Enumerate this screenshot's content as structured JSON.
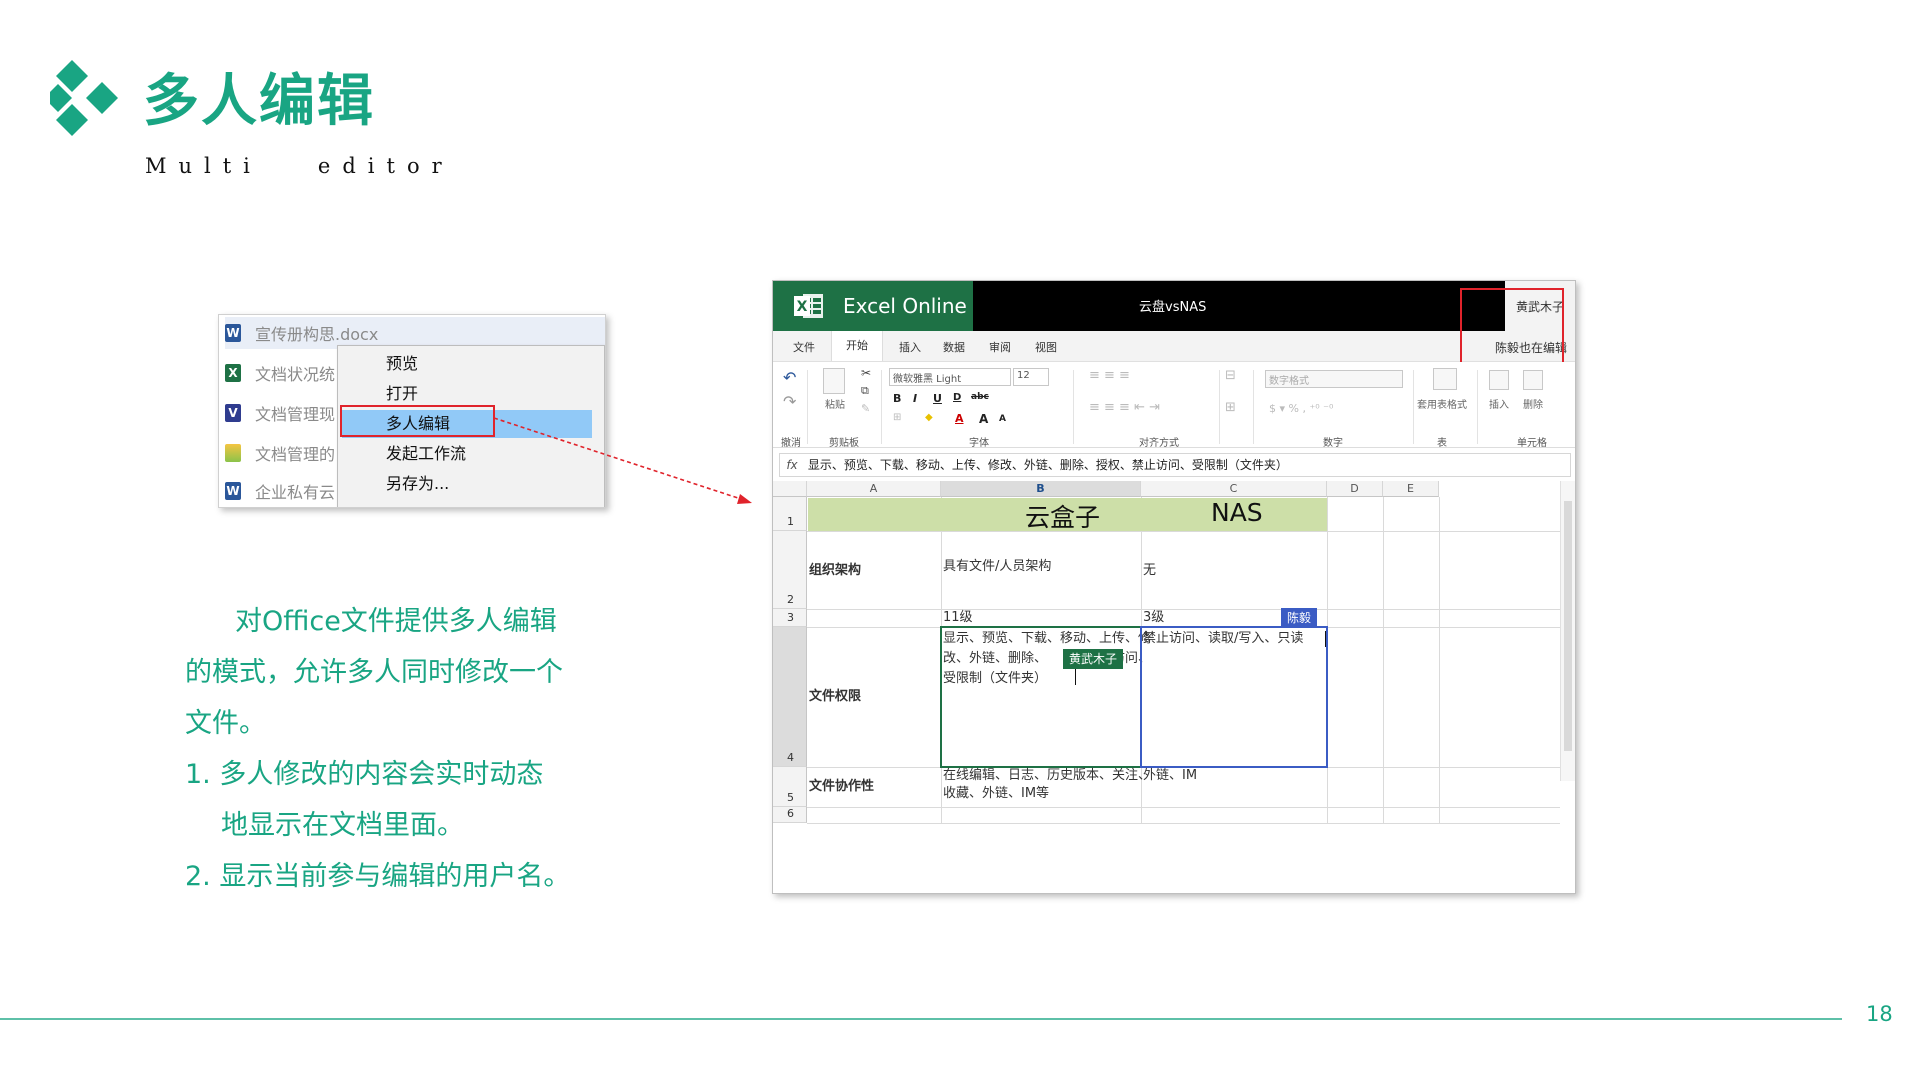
{
  "slide": {
    "title": "多人编辑",
    "subtitle": "Multi   editor",
    "page_number": "18",
    "accent_color": "#19a583"
  },
  "context_menu_screenshot": {
    "files": [
      {
        "icon": "word-icon",
        "letter": "W",
        "name": "宣传册构思.docx"
      },
      {
        "icon": "excel-icon",
        "letter": "X",
        "name": "文档状况统"
      },
      {
        "icon": "visio-icon",
        "letter": "V",
        "name": "文档管理现"
      },
      {
        "icon": "image-icon",
        "letter": "",
        "name": "文档管理的"
      },
      {
        "icon": "word-icon",
        "letter": "W",
        "name": "企业私有云"
      }
    ],
    "menu_items": [
      "预览",
      "打开",
      "多人编辑",
      "发起工作流",
      "另存为..."
    ],
    "selected_item": "多人编辑"
  },
  "description": {
    "intro_line1": "对Office文件提供多人编辑",
    "intro_line2": "的模式，允许多人同时修改一个",
    "intro_line3": "文件。",
    "point1_line1": "1. 多人修改的内容会实时动态",
    "point1_line2": "地显示在文档里面。",
    "point2": "2. 显示当前参与编辑的用户名。"
  },
  "excel": {
    "app_name": "Excel Online",
    "document_name": "云盘vsNAS",
    "user_1": "黄武木子",
    "user_2": "陈毅也在编辑",
    "tabs": [
      "文件",
      "开始",
      "插入",
      "数据",
      "审阅",
      "视图"
    ],
    "active_tab": "开始",
    "ribbon": {
      "undo_group": "撤消",
      "paste_label": "粘贴",
      "clipboard_group": "剪贴板",
      "font_name": "微软雅黑 Light",
      "font_size": "12",
      "font_group": "字体",
      "align_group": "对齐方式",
      "number_format": "数字格式",
      "number_group": "数字",
      "table_format_label": "套用表格式",
      "table_group": "表",
      "insert_label": "插入",
      "delete_label": "删除",
      "cells_group": "单元格"
    },
    "formula_bar": "显示、预览、下载、移动、上传、修改、外链、删除、授权、禁止访问、受限制（文件夹）",
    "columns": [
      "A",
      "B",
      "C",
      "D",
      "E"
    ],
    "active_column": "B",
    "rows": [
      "1",
      "2",
      "3",
      "4",
      "5",
      "6"
    ],
    "active_row": "4",
    "header_b": "云盒子",
    "header_c": "NAS",
    "r2_a": "组织架构",
    "r2_b": "具有文件/人员架构",
    "r2_c": "无",
    "r3_b": "11级",
    "r3_c": "3级",
    "r4_a": "文件权限",
    "r4_b_l1": "显示、预览、下载、移动、上传、修",
    "r4_b_l2": "改、外链、删除、",
    "r4_b_l2_tail": "止访问、",
    "r4_b_l3": "受限制（文件夹）",
    "r4_c": "禁止访问、读取/写入、只读",
    "r5_a": "文件协作性",
    "r5_b_l1": "在线编辑、日志、历史版本、关注、",
    "r5_b_l2": "收藏、外链、IM等",
    "r5_c": "外链、IM",
    "cursor_tag_b": "黄武木子",
    "cursor_tag_c": "陈毅"
  }
}
